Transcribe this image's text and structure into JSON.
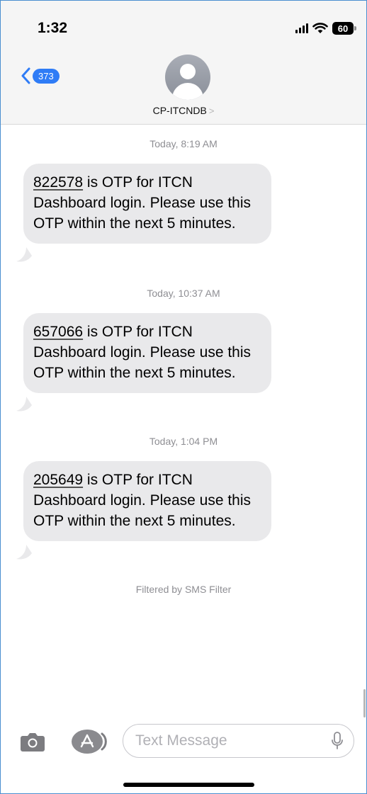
{
  "status_bar": {
    "time": "1:32",
    "battery": "60"
  },
  "nav": {
    "back_count": "373",
    "contact_name": "CP-ITCNDB",
    "contact_chevron": ">"
  },
  "messages": [
    {
      "timestamp": "Today, 8:19 AM",
      "otp": "822578",
      "text": " is OTP for ITCN Dashboard login. Please use this OTP within the next 5 minutes."
    },
    {
      "timestamp": "Today, 10:37 AM",
      "otp": "657066",
      "text": " is OTP for ITCN Dashboard login. Please use this OTP within the next 5 minutes."
    },
    {
      "timestamp": "Today, 1:04 PM",
      "otp": "205649",
      "text": " is OTP for ITCN Dashboard login. Please use this OTP within the next 5 minutes."
    }
  ],
  "footer_note": "Filtered by SMS Filter",
  "input_bar": {
    "placeholder": "Text Message",
    "value": ""
  },
  "colors": {
    "accent": "#2f7cf6",
    "bubble": "#e9e9eb",
    "meta_text": "#8e8e93",
    "frame_border": "#4a8fd0"
  },
  "icons": [
    "camera-icon",
    "app-store-icon",
    "microphone-icon",
    "chevron-left-icon",
    "avatar-icon",
    "signal-icon",
    "wifi-icon",
    "battery-icon"
  ]
}
